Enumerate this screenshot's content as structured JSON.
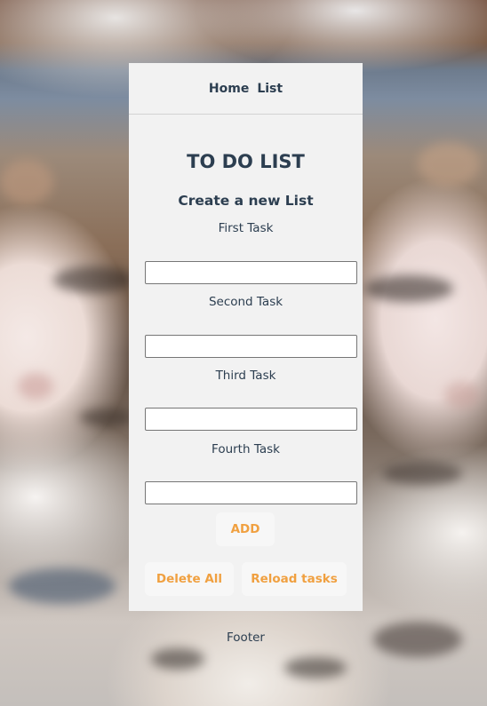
{
  "nav": {
    "home_label": "Home",
    "list_label": "List"
  },
  "page": {
    "title": "TO DO LIST",
    "subtitle": "Create a new List"
  },
  "tasks": [
    {
      "label": "First Task",
      "value": ""
    },
    {
      "label": "Second Task",
      "value": ""
    },
    {
      "label": "Third Task",
      "value": ""
    },
    {
      "label": "Fourth Task",
      "value": ""
    }
  ],
  "buttons": {
    "add_label": "ADD",
    "delete_all_label": "Delete All",
    "reload_label": "Reload tasks"
  },
  "footer": {
    "text": "Footer"
  },
  "colors": {
    "accent": "#f0a040",
    "text": "#2c3e50",
    "card_background": "#f2f2f2"
  }
}
